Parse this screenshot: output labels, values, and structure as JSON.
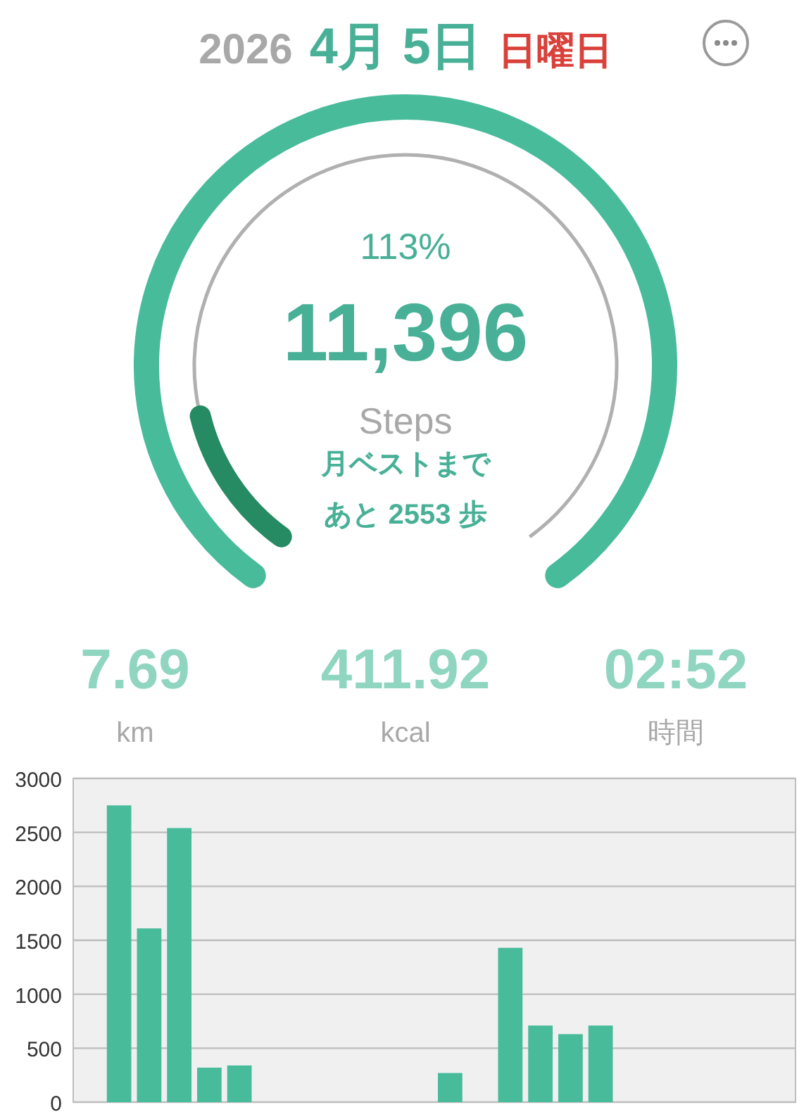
{
  "header": {
    "year": "2026",
    "date": "4月 5日",
    "weekday": "日曜日"
  },
  "ring": {
    "percent": "113%",
    "steps": "11,396",
    "unit": "Steps",
    "best_line_1": "月ベストまで",
    "best_line_2": "あと 2553 歩"
  },
  "stats": [
    {
      "value": "7.69",
      "unit": "km"
    },
    {
      "value": "411.92",
      "unit": "kcal"
    },
    {
      "value": "02:52",
      "unit": "時間"
    }
  ],
  "chart_data": {
    "type": "bar",
    "grid": true,
    "ylim": [
      0,
      3000
    ],
    "yticks": [
      0,
      500,
      1000,
      1500,
      2000,
      2500,
      3000
    ],
    "series": [
      {
        "color": "#48bb9b",
        "values": [
          0,
          2750,
          1610,
          2540,
          320,
          340,
          0,
          0,
          0,
          0,
          0,
          0,
          270,
          0,
          1430,
          710,
          630,
          710,
          0,
          0,
          0,
          0,
          0,
          0
        ]
      }
    ]
  }
}
